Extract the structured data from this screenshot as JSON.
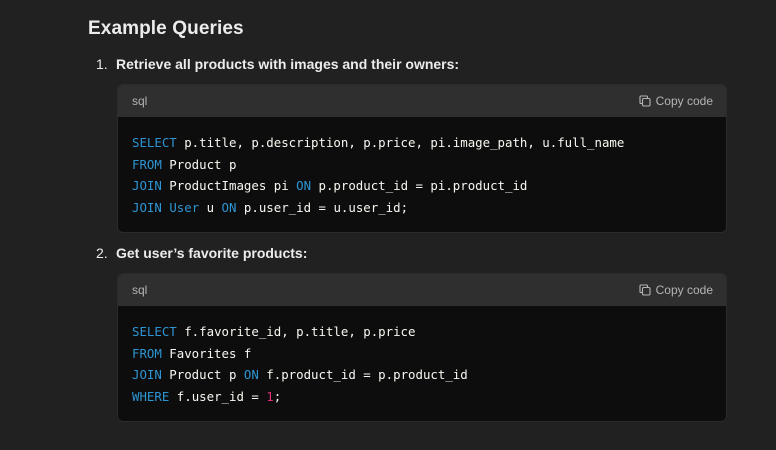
{
  "heading": "Example Queries",
  "items": [
    {
      "number": "1.",
      "title": "Retrieve all products with images and their owners:",
      "code_language": "sql",
      "copy_label": "Copy code",
      "lines": [
        [
          {
            "t": "kw",
            "v": "SELECT"
          },
          {
            "t": "plain",
            "v": " p.title, p.description, p.price, pi.image_path, u.full_name"
          }
        ],
        [
          {
            "t": "kw",
            "v": "FROM"
          },
          {
            "t": "plain",
            "v": " Product p"
          }
        ],
        [
          {
            "t": "kw",
            "v": "JOIN"
          },
          {
            "t": "plain",
            "v": " ProductImages pi "
          },
          {
            "t": "kw",
            "v": "ON"
          },
          {
            "t": "plain",
            "v": " p.product_id = pi.product_id"
          }
        ],
        [
          {
            "t": "kw",
            "v": "JOIN"
          },
          {
            "t": "plain",
            "v": " "
          },
          {
            "t": "kw",
            "v": "User"
          },
          {
            "t": "plain",
            "v": " u "
          },
          {
            "t": "kw",
            "v": "ON"
          },
          {
            "t": "plain",
            "v": " p.user_id = u.user_id;"
          }
        ]
      ]
    },
    {
      "number": "2.",
      "title": "Get user’s favorite products:",
      "code_language": "sql",
      "copy_label": "Copy code",
      "lines": [
        [
          {
            "t": "kw",
            "v": "SELECT"
          },
          {
            "t": "plain",
            "v": " f.favorite_id, p.title, p.price"
          }
        ],
        [
          {
            "t": "kw",
            "v": "FROM"
          },
          {
            "t": "plain",
            "v": " Favorites f"
          }
        ],
        [
          {
            "t": "kw",
            "v": "JOIN"
          },
          {
            "t": "plain",
            "v": " Product p "
          },
          {
            "t": "kw",
            "v": "ON"
          },
          {
            "t": "plain",
            "v": " f.product_id = p.product_id"
          }
        ],
        [
          {
            "t": "kw",
            "v": "WHERE"
          },
          {
            "t": "plain",
            "v": " f.user_id = "
          },
          {
            "t": "num-lit",
            "v": "1"
          },
          {
            "t": "plain",
            "v": ";"
          }
        ]
      ]
    }
  ],
  "colors": {
    "background": "#212121",
    "code_background": "#0d0d0d",
    "code_header": "#2f2f2f",
    "keyword": "#2e95d3",
    "number_literal": "#df3079"
  },
  "icons": {
    "copy": "copy-icon"
  }
}
